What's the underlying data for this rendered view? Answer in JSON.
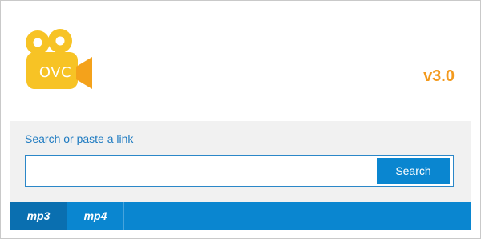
{
  "app": {
    "logo_text": "OVC",
    "version": "v3.0"
  },
  "search": {
    "prompt": "Search or paste a link",
    "value": "",
    "placeholder": "",
    "button_label": "Search"
  },
  "tabs": [
    {
      "label": "mp3",
      "selected": true
    },
    {
      "label": "mp4",
      "selected": false
    }
  ],
  "colors": {
    "logo_yellow": "#f7c325",
    "logo_orange": "#f4a21b",
    "version": "#f39a1e",
    "accent_blue": "#0a86d0",
    "selected_tab": "#0a6fb0",
    "link_blue": "#1f7bc1",
    "panel_bg": "#f1f1f1"
  },
  "icons": {
    "logo": "movie-camera-icon"
  }
}
